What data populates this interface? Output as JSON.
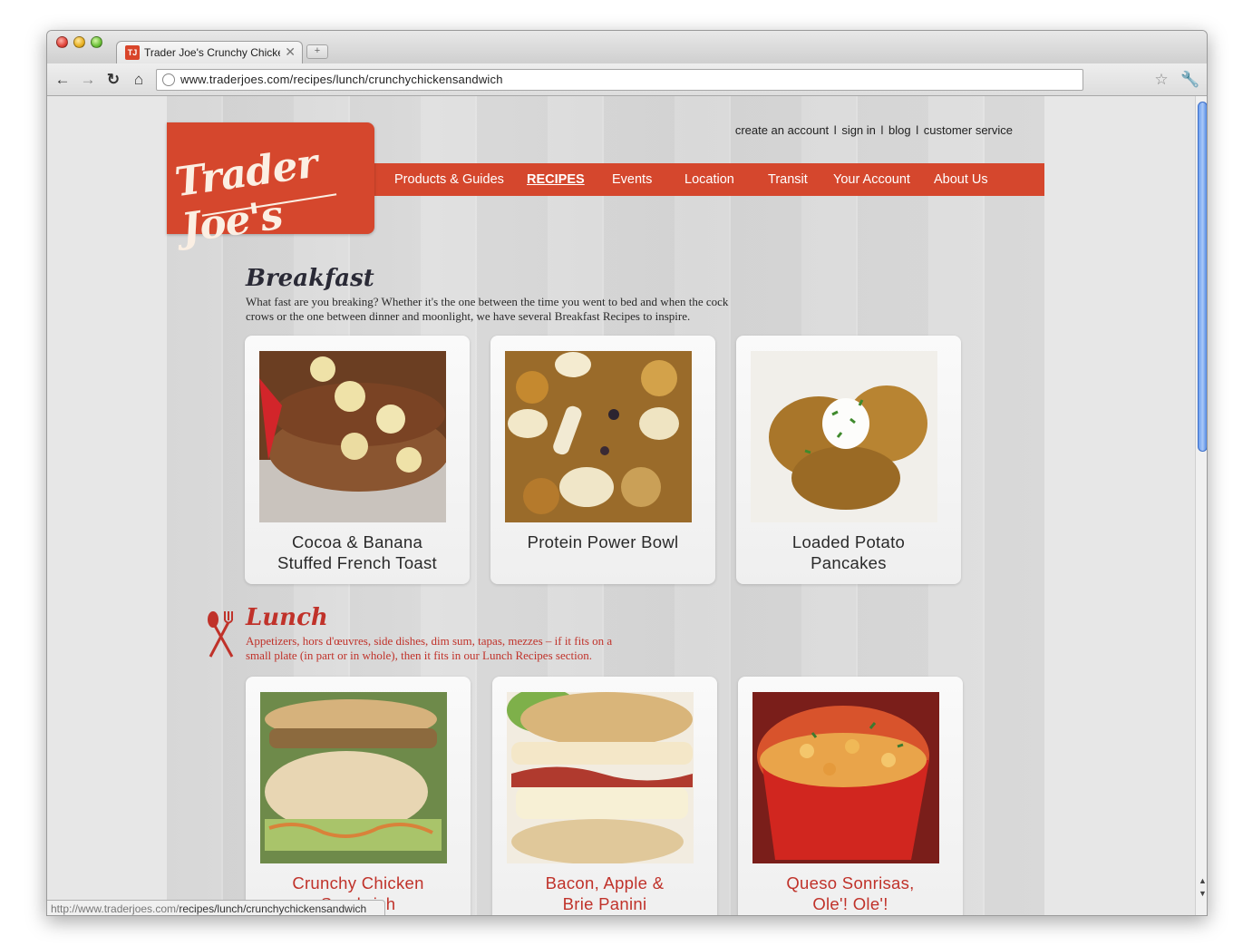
{
  "browser": {
    "tab_title": "Trader Joe's Crunchy Chicken",
    "favicon_text": "TJ",
    "url": "www.traderjoes.com/recipes/lunch/crunchychickensandwich",
    "status_url_host": "http://www.traderjoes.com/",
    "status_url_path": "recipes/lunch/crunchychickensandwich"
  },
  "header": {
    "logo_text": "Trader Joe's",
    "utility_links": [
      "create an account",
      "sign in",
      "blog",
      "customer service"
    ],
    "utility_separator": "l"
  },
  "nav": {
    "items": [
      "Products & Guides",
      "RECIPES",
      "Events",
      "Location",
      "Transit",
      "Your Account",
      "About Us"
    ],
    "active": "RECIPES"
  },
  "breakfast": {
    "title": "Breakfast",
    "description": "What fast are you breaking? Whether it's the one between the time you went to bed and when the cock crows or the one between dinner and moonlight, we have several Breakfast Recipes to inspire.",
    "cards": [
      {
        "label_lines": [
          "Cocoa & Banana",
          "Stuffed French Toast"
        ]
      },
      {
        "label_lines": [
          "Protein Power Bowl"
        ]
      },
      {
        "label_lines": [
          "Loaded Potato",
          "Pancakes"
        ]
      }
    ]
  },
  "lunch": {
    "title": "Lunch",
    "description": "Appetizers, hors d'œuvres, side dishes, dim sum, tapas, mezzes – if it fits on a small plate (in part or in whole), then it fits in our Lunch Recipes section.",
    "cards": [
      {
        "label_lines": [
          "Crunchy Chicken",
          "Sandwich"
        ]
      },
      {
        "label_lines": [
          "Bacon, Apple &",
          "Brie Panini"
        ]
      },
      {
        "label_lines": [
          "Queso Sonrisas,",
          "Ole'! Ole'!"
        ]
      }
    ]
  },
  "colors": {
    "brand_red": "#d5472d",
    "lunch_red": "#c0322a",
    "breakfast_ink": "#2a2a36"
  }
}
